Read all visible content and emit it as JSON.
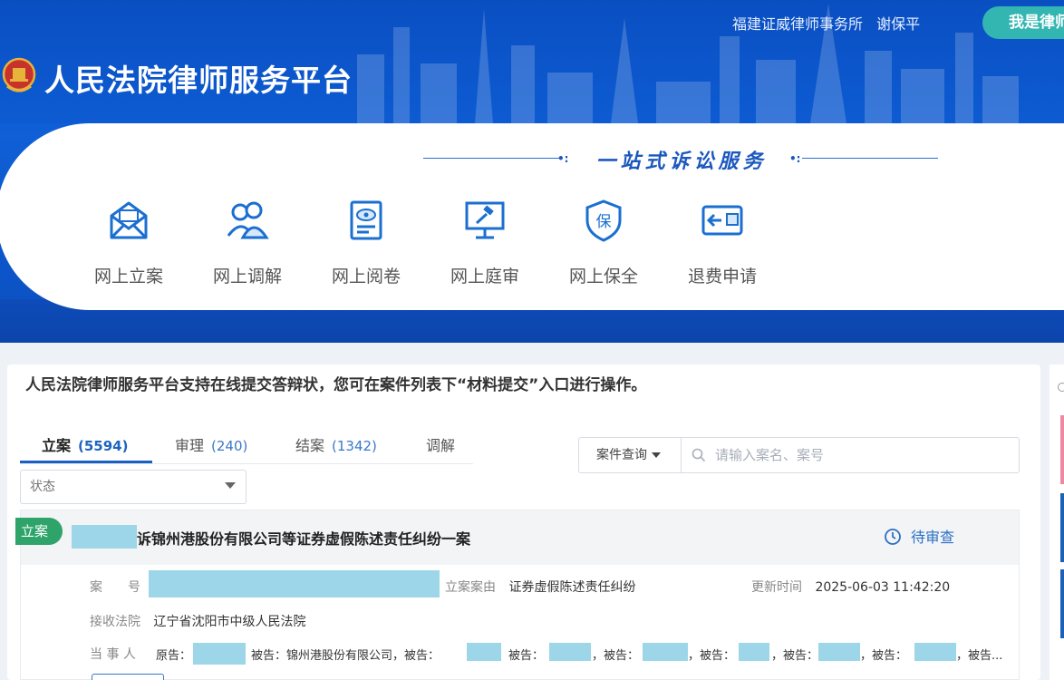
{
  "header": {
    "site_title": "人民法院律师服务平台",
    "firm_name": "福建证威律师事务所",
    "user_name": "谢保平",
    "role_button": "我是律师",
    "slogan": "一站式诉讼服务"
  },
  "services": [
    {
      "label": "网上立案",
      "icon": "envelope-icon"
    },
    {
      "label": "网上调解",
      "icon": "users-icon"
    },
    {
      "label": "网上阅卷",
      "icon": "document-eye-icon"
    },
    {
      "label": "网上庭审",
      "icon": "gavel-screen-icon"
    },
    {
      "label": "网上保全",
      "icon": "shield-bao-icon"
    },
    {
      "label": "退费申请",
      "icon": "refund-card-icon"
    }
  ],
  "service_icon_glyph": "保",
  "notice": "人民法院律师服务平台支持在线提交答辩状，您可在案件列表下“材料提交”入口进行操作。",
  "tabs": [
    {
      "label": "立案",
      "count": "(5594)",
      "active": true
    },
    {
      "label": "审理",
      "count": "(240)",
      "active": false
    },
    {
      "label": "结案",
      "count": "(1342)",
      "active": false
    },
    {
      "label": "调解",
      "count": "",
      "active": false
    }
  ],
  "filters": {
    "status_placeholder": "状态",
    "search_type": "案件查询",
    "search_placeholder": "请输入案名、案号"
  },
  "case": {
    "badge": "立案",
    "title": "诉锦州港股份有限公司等证券虚假陈述责任纠纷一案",
    "status": "待审查",
    "case_no_label": "案　　号",
    "cause_label": "立案案由",
    "cause_value": "证券虚假陈述责任纠纷",
    "updated_label": "更新时间",
    "updated_value": "2025-06-03 11:42:20",
    "court_label": "接收法院",
    "court_value": "辽宁省沈阳市中级人民法院",
    "parties_label": "当 事 人",
    "plaintiff_label": "原告：",
    "defendant_label": "被告：",
    "defendant_named": "锦州港股份有限公司，",
    "comma": "，",
    "trailing": "被告..."
  },
  "colors": {
    "brand_blue": "#0f5fd6",
    "accent_teal": "#33b6b2",
    "badge_green": "#2ea46a",
    "link_blue": "#2c6fc6"
  }
}
